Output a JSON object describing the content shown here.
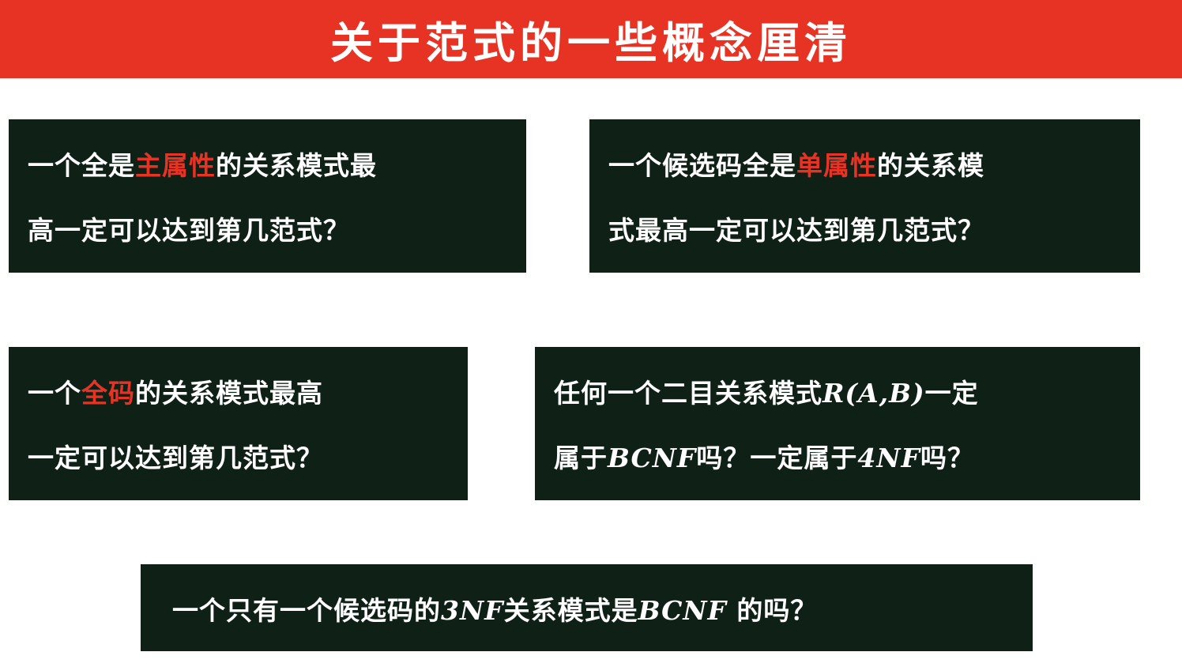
{
  "title": "关于范式的一些概念厘清",
  "colors": {
    "accent": "#e63324",
    "card_bg": "#0f2017",
    "text": "#ffffff"
  },
  "cards": [
    {
      "line1_a": "一个全是",
      "line1_hl": "主属性",
      "line1_b": "的关系模式最",
      "line2": "高一定可以达到第几范式？"
    },
    {
      "line1_a": "一个候选码全是",
      "line1_hl": "单属性",
      "line1_b": "的关系模",
      "line2": "式最高一定可以达到第几范式？"
    },
    {
      "line1_a": "一个",
      "line1_hl": "全码",
      "line1_b": "的关系模式最高",
      "line2": "一定可以达到第几范式？"
    },
    {
      "line1_a": "任何一个二目关系模式",
      "line1_math": "R(A,B)",
      "line1_b": "一定",
      "line2_a": "属于",
      "line2_math1": "BCNF",
      "line2_b": "吗？一定属于",
      "line2_math2": "4NF",
      "line2_c": "吗？"
    },
    {
      "line1_a": "一个只有一个候选码的",
      "line1_math1": "3NF",
      "line1_b": "关系模式是",
      "line1_math2": "BCNF",
      "line1_c": " 的吗？"
    }
  ]
}
